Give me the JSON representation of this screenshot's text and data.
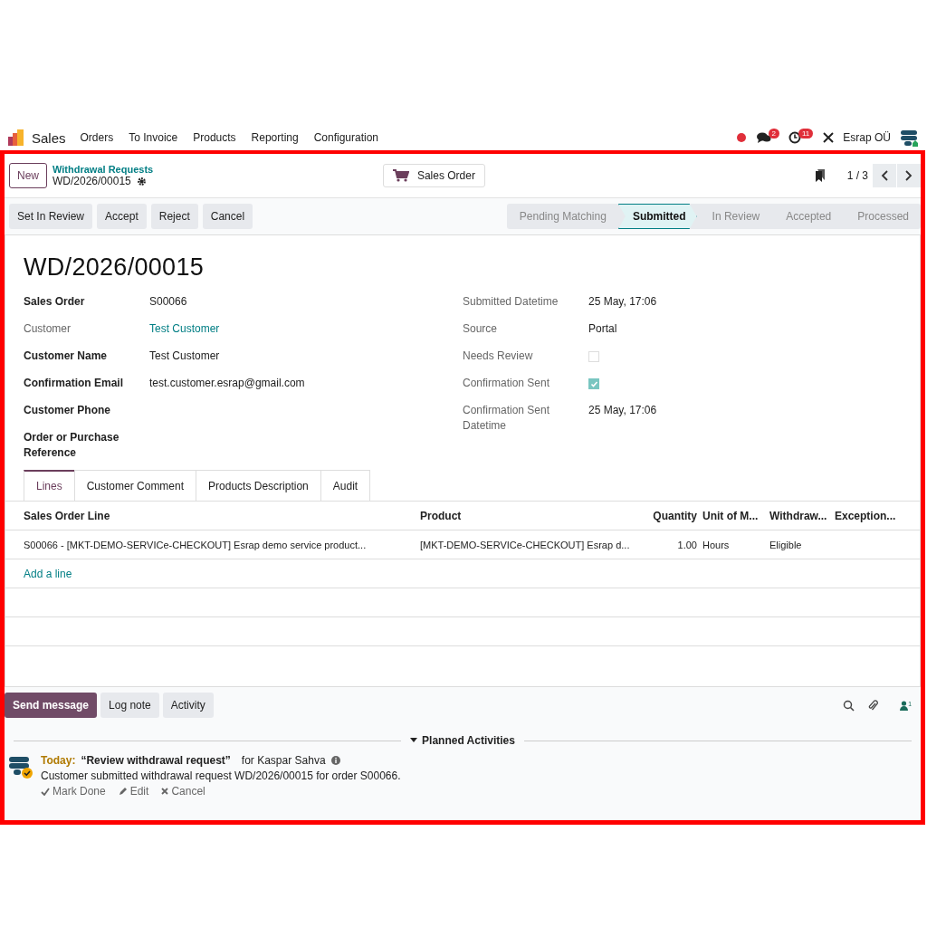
{
  "navbar": {
    "app": "Sales",
    "menu": [
      "Orders",
      "To Invoice",
      "Products",
      "Reporting",
      "Configuration"
    ],
    "messages_badge": "2",
    "activities_badge": "11",
    "company": "Esrap OÜ"
  },
  "breadcrumb": {
    "parent": "Withdrawal Requests",
    "current": "WD/2026/00015"
  },
  "new_button": "New",
  "smart_button": "Sales Order",
  "pager": "1 / 3",
  "actions": [
    "Set In Review",
    "Accept",
    "Reject",
    "Cancel"
  ],
  "stages": [
    {
      "label": "Pending Matching",
      "selected": false
    },
    {
      "label": "Submitted",
      "selected": true
    },
    {
      "label": "In Review",
      "selected": false
    },
    {
      "label": "Accepted",
      "selected": false
    },
    {
      "label": "Processed",
      "selected": false
    }
  ],
  "title": "WD/2026/00015",
  "left_fields": [
    {
      "label": "Sales Order",
      "kind": "text",
      "value": "S00066"
    },
    {
      "label": "Customer",
      "kind": "link",
      "value": "Test Customer"
    },
    {
      "label": "Customer Name",
      "kind": "text",
      "value": "Test Customer"
    },
    {
      "label": "Confirmation Email",
      "kind": "text",
      "value": "test.customer.esrap@gmail.com"
    },
    {
      "label": "Customer Phone",
      "kind": "text"
    },
    {
      "label": "Order or Purchase Reference",
      "kind": "text"
    }
  ],
  "right_fields": [
    {
      "label": "Submitted Datetime",
      "kind": "text",
      "value": "25 May, 17:06"
    },
    {
      "label": "Source",
      "kind": "text",
      "value": "Portal"
    },
    {
      "label": "Needs Review",
      "kind": "checkbox",
      "checked": false
    },
    {
      "label": "Confirmation Sent",
      "kind": "checkbox",
      "checked": true
    },
    {
      "label": "Confirmation Sent Datetime",
      "kind": "text",
      "value": "25 May, 17:06"
    }
  ],
  "tabs": [
    {
      "label": "Lines",
      "selected": true
    },
    {
      "label": "Customer Comment",
      "selected": false
    },
    {
      "label": "Products Description",
      "selected": false
    },
    {
      "label": "Audit",
      "selected": false
    }
  ],
  "table": {
    "columns": [
      "Sales Order Line",
      "Product",
      "Quantity",
      "Unit of M...",
      "Withdraw...",
      "Exception..."
    ],
    "rows": [
      [
        "S00066 - [MKT-DEMO-SERVICe-CHECKOUT] Esrap demo service product...",
        "[MKT-DEMO-SERVICe-CHECKOUT] Esrap d...",
        "1.00",
        "Hours",
        "Eligible",
        ""
      ]
    ],
    "add_line": "Add a line"
  },
  "chatter": {
    "buttons": [
      {
        "label": "Send message",
        "kind": "primary"
      },
      {
        "label": "Log note",
        "kind": "secondary"
      },
      {
        "label": "Activity",
        "kind": "secondary"
      }
    ],
    "followers": "1",
    "section": "Planned Activities",
    "activity": {
      "when": "Today:",
      "summary": "“Review withdrawal request”",
      "assignee": "for Kaspar Sahva",
      "note": "Customer submitted withdrawal request WD/2026/00015 for order S00066.",
      "actions": [
        "Mark Done",
        "Edit",
        "Cancel"
      ]
    }
  }
}
